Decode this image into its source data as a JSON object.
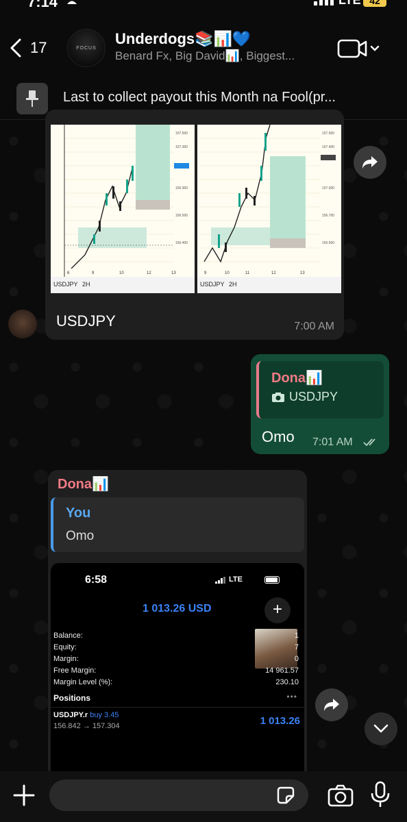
{
  "status_bar": {
    "time": "7:14",
    "network": "LTE",
    "battery": "42"
  },
  "header": {
    "back_count": "17",
    "avatar_text": "FOCUS",
    "group_name": "Underdogs📚📊💙",
    "members": "Benard Fx, Big David📊, Biggest..."
  },
  "pinned": {
    "text": "Last to collect payout this Month na Fool(pr..."
  },
  "messages": {
    "image_msg": {
      "caption": "USDJPY",
      "time": "7:00 AM",
      "chart_left": {
        "symbol": "USDJPY",
        "timeframe": "2H",
        "x_ticks": [
          "6",
          "9",
          "10",
          "12",
          "13"
        ]
      },
      "chart_right": {
        "symbol": "USDJPY",
        "timeframe": "2H",
        "x_ticks": [
          "9",
          "10",
          "11",
          "12",
          "13"
        ]
      }
    },
    "outgoing": {
      "quote_name": "Dona📊",
      "quote_text": "USDJPY",
      "text": "Omo",
      "time": "7:01 AM"
    },
    "reply": {
      "sender": "Dona📊",
      "quote_name": "You",
      "quote_text": "Omo",
      "screenshot": {
        "time": "6:58",
        "network": "LTE",
        "equity": "1 013.26 USD",
        "rows": [
          {
            "label": "Balance:",
            "value": "1"
          },
          {
            "label": "Equity:",
            "value": "7"
          },
          {
            "label": "Margin:",
            "value": "0"
          },
          {
            "label": "Free Margin:",
            "value": "14 961.57"
          },
          {
            "label": "Margin Level (%):",
            "value": "230.10"
          }
        ],
        "positions_label": "Positions",
        "position": {
          "symbol": "USDJPY.r",
          "side": "buy 3.45",
          "prices": "156.842 → 157.304",
          "profit": "1 013.26"
        }
      }
    }
  },
  "input": {
    "placeholder": ""
  },
  "colors": {
    "outgoing_bubble": "#144d37",
    "incoming_bubble": "#1f1f1f",
    "quote_name_red": "#f07b86",
    "quote_name_blue": "#5aa7ef",
    "accent_blue": "#3b82f6"
  }
}
